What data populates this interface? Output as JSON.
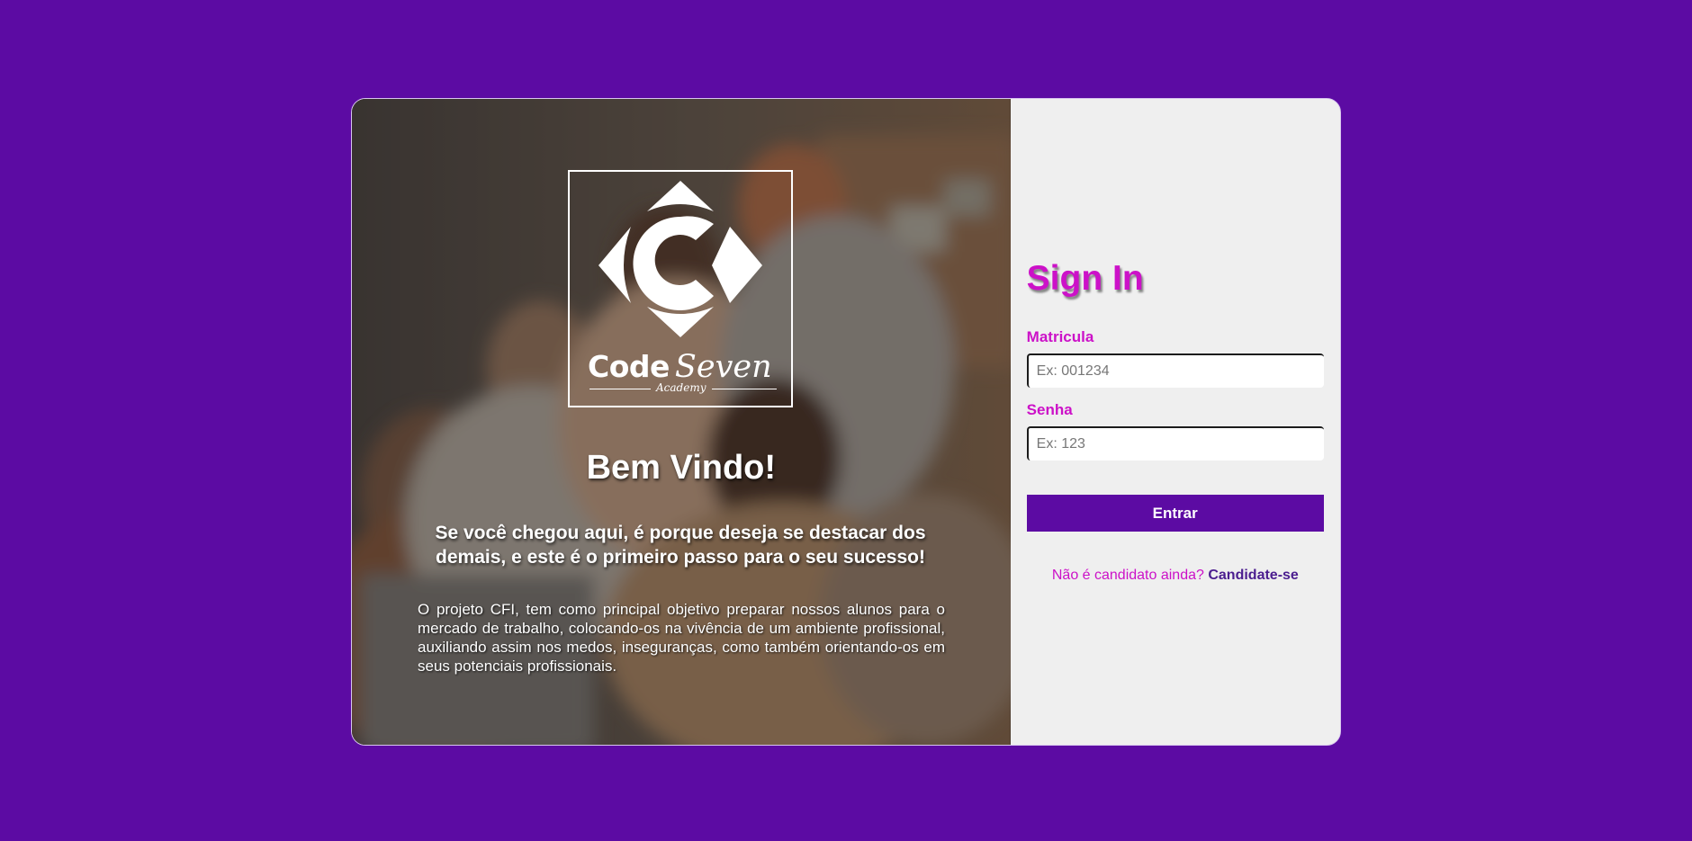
{
  "theme": {
    "background": "#5c0ba3",
    "accent": "#cc11c8",
    "button": "#5c0ba3",
    "link": "#4b1d8f",
    "panel": "#efefef"
  },
  "hero": {
    "logo": {
      "word_main": "Code",
      "word_secondary": "Seven",
      "word_sub": "Academy",
      "icon": "code-seven-logo-icon"
    },
    "welcome": "Bem Vindo!",
    "tagline": "Se você chegou aqui, é porque deseja se destacar dos demais, e este é o primeiro passo para o seu sucesso!",
    "description": "O projeto CFI, tem como principal objetivo preparar nossos alunos para o mercado de trabalho, colocando-os na vivência de um ambiente profissional, auxiliando assim nos medos, inseguranças, como também orientando-os em seus potenciais profissionais."
  },
  "form": {
    "title": "Sign In",
    "matricula": {
      "label": "Matricula",
      "placeholder": "Ex: 001234",
      "value": ""
    },
    "senha": {
      "label": "Senha",
      "placeholder": "Ex: 123",
      "value": ""
    },
    "submit_label": "Entrar",
    "signup_prompt": "Não é candidato ainda?",
    "signup_link": "Candidate-se"
  }
}
